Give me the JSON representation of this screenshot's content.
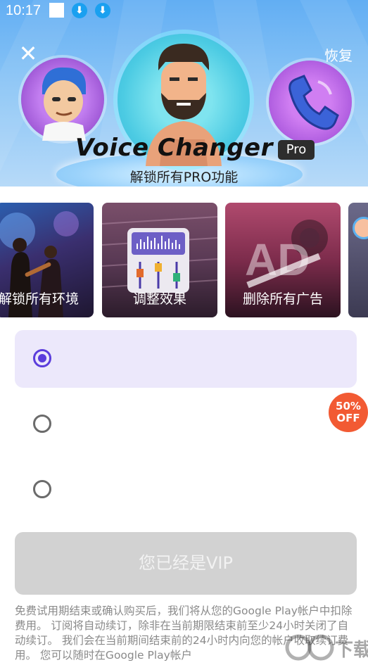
{
  "status_bar": {
    "time": "10:17"
  },
  "header": {
    "close_glyph": "✕",
    "restore_label": "恢复",
    "brand": "Voice Changer",
    "pro_badge": "Pro",
    "subtitle": "解锁所有PRO功能"
  },
  "features": [
    {
      "label": "解锁所有环境",
      "icon": "concert-photo"
    },
    {
      "label": "调整效果",
      "icon": "equalizer-icon"
    },
    {
      "label": "删除所有广告",
      "icon": "ad-icon",
      "ad_text": "AD"
    },
    {
      "label": "",
      "icon": "avatar-icon"
    }
  ],
  "plans": [
    {
      "selected": true,
      "label": ""
    },
    {
      "selected": false,
      "label": ""
    },
    {
      "selected": false,
      "label": ""
    }
  ],
  "discount_badge": {
    "line1": "50%",
    "line2": "OFF"
  },
  "vip_button_label": "您已经是VIP",
  "legal_text": "免费试用期结束或确认购买后，我们将从您的Google Play帐户中扣除费用。 订阅将自动续订，除非在当前期限结束前至少24小时关闭了自动续订。 我们会在当前期间结束前的24小时内向您的帐户收取续订费用。 您可以随时在Google Play帐户",
  "watermark": "下载",
  "colors": {
    "accent": "#5b3ddc",
    "selected_plan_bg": "#ece8fb",
    "discount": "#f25a33",
    "disabled_button": "#d2d2d2"
  }
}
